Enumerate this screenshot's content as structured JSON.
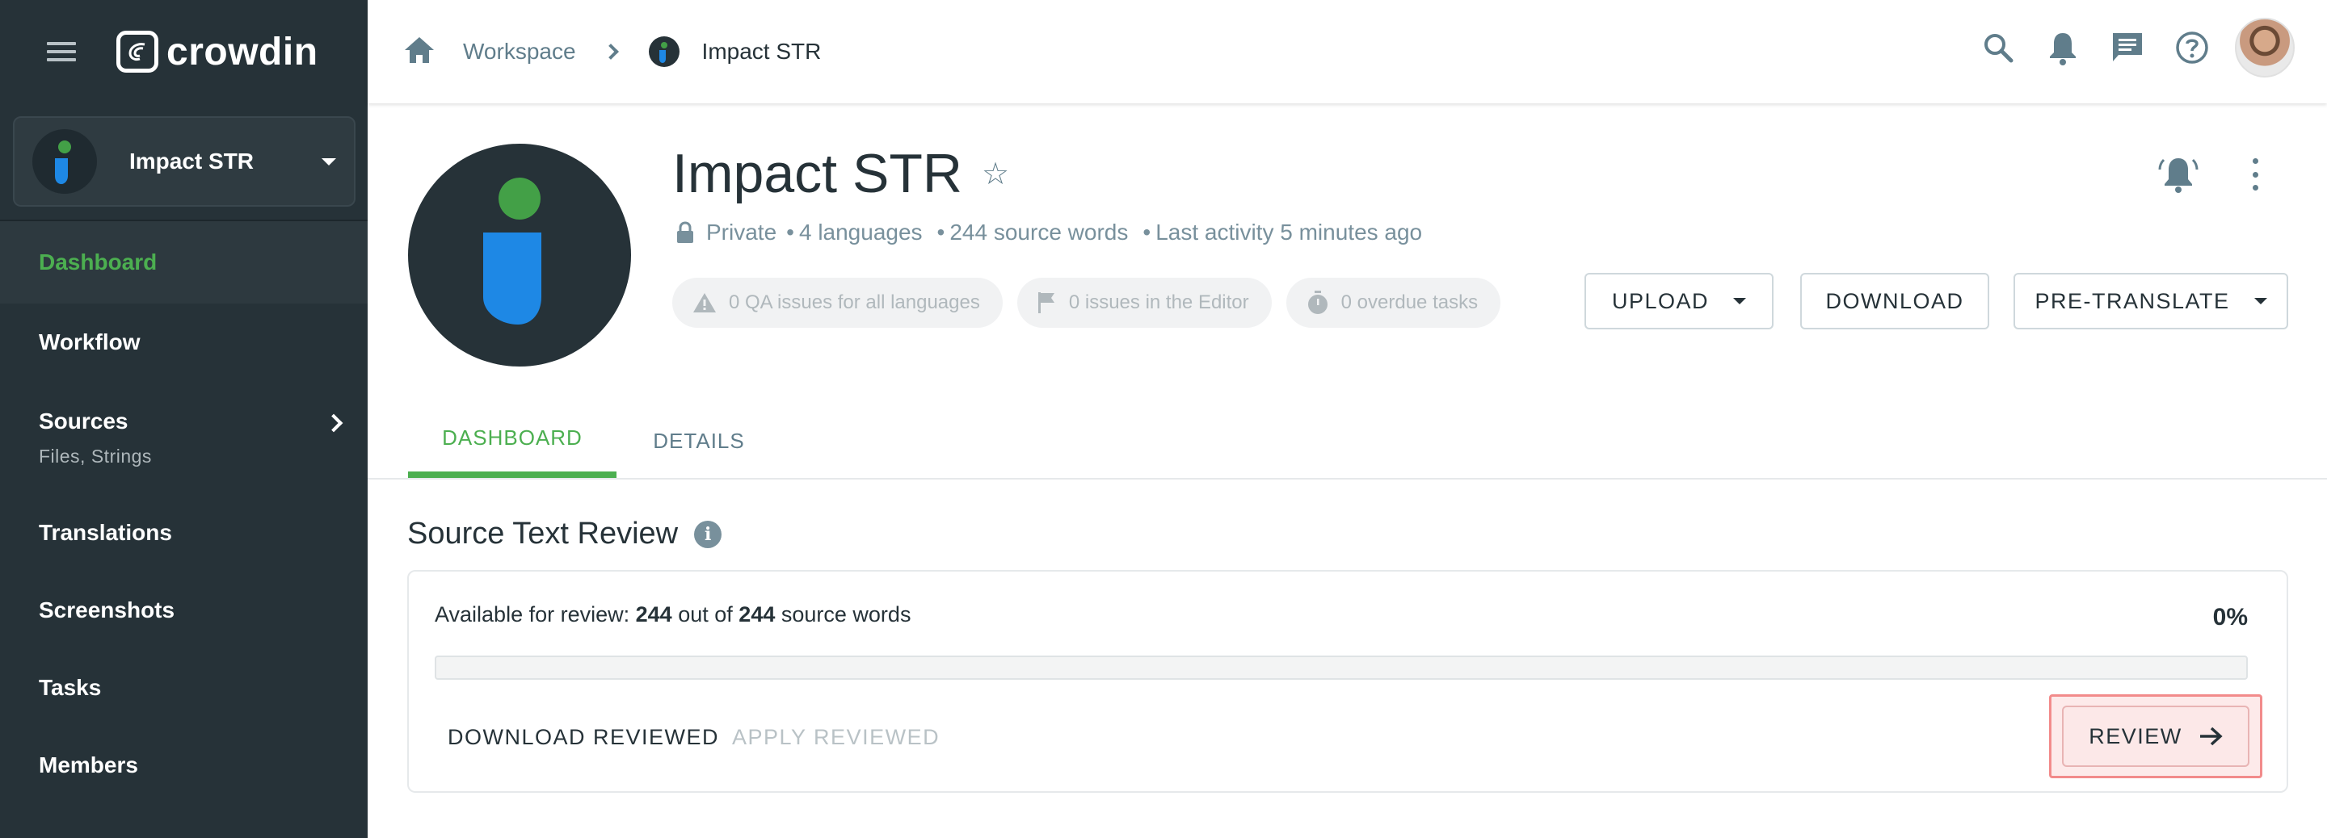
{
  "sidebar": {
    "logo_text": "crowdin",
    "project_name": "Impact STR",
    "items": [
      {
        "label": "Dashboard",
        "active": true
      },
      {
        "label": "Workflow"
      },
      {
        "label": "Sources",
        "sub": "Files, Strings"
      },
      {
        "label": "Translations"
      },
      {
        "label": "Screenshots"
      },
      {
        "label": "Tasks"
      },
      {
        "label": "Members"
      }
    ]
  },
  "breadcrumb": {
    "workspace": "Workspace",
    "project": "Impact STR"
  },
  "project": {
    "title": "Impact STR",
    "visibility": "Private",
    "languages": "4 languages",
    "source_words": "244 source words",
    "last_activity": "Last activity 5 minutes ago",
    "chips": [
      {
        "label": "0 QA issues for all languages",
        "icon": "warning-icon"
      },
      {
        "label": "0 issues in the Editor",
        "icon": "flag-icon"
      },
      {
        "label": "0 overdue tasks",
        "icon": "stopwatch-icon"
      }
    ],
    "buttons": {
      "upload": "UPLOAD",
      "download": "DOWNLOAD",
      "pretranslate": "PRE-TRANSLATE"
    }
  },
  "tabs": [
    {
      "label": "DASHBOARD",
      "active": true
    },
    {
      "label": "DETAILS"
    }
  ],
  "review": {
    "title": "Source Text Review",
    "available_prefix": "Available for review:",
    "available_count": "244",
    "available_mid": "out of",
    "total_count": "244",
    "available_suffix": "source words",
    "percent": "0%",
    "progress": 0,
    "download_reviewed": "DOWNLOAD REVIEWED",
    "apply_reviewed": "APPLY REVIEWED",
    "review_button": "REVIEW"
  },
  "colors": {
    "sidebar_bg": "#263238",
    "accent": "#4caf50",
    "project_avatar_green": "#43a047",
    "project_avatar_blue": "#1e88e5"
  }
}
